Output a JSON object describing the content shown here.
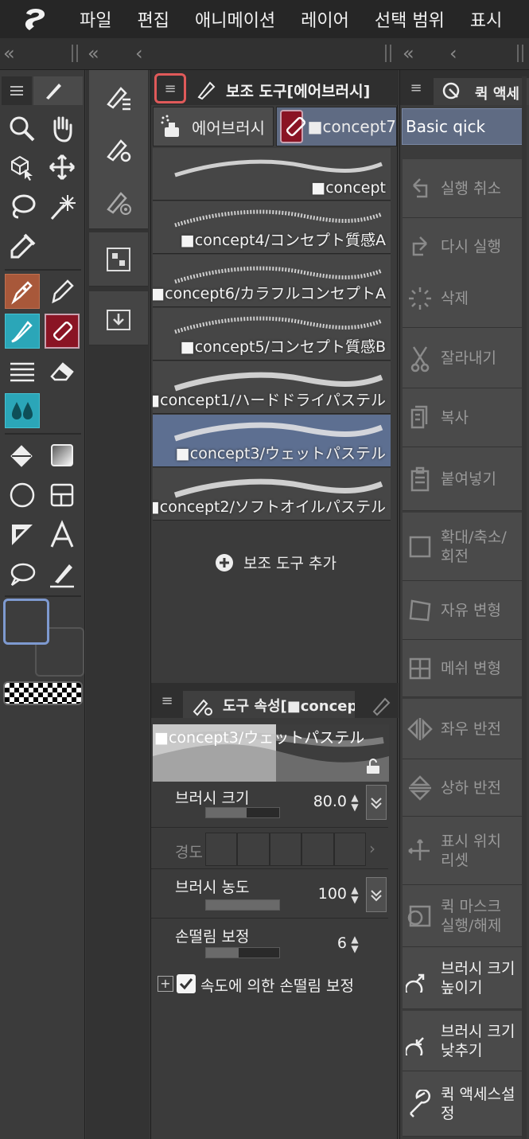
{
  "menubar": {
    "logo_icon": "clip-studio-logo-icon",
    "items": [
      "파일",
      "편집",
      "애니메이션",
      "레이어",
      "선택 범위",
      "표시"
    ]
  },
  "dock": {
    "collapse_left": "«",
    "collapse_right": "‹"
  },
  "tools_panel": {
    "tools": [
      "zoom-icon",
      "hand-icon",
      "object-select-icon",
      "move-layer-icon",
      "lasso-icon",
      "magic-wand-icon",
      "eyedropper-icon",
      "pen-icon",
      "pencil-icon",
      "brush-icon",
      "airbrush-icon",
      "hatch-icon",
      "eraser-icon",
      "blend-icon",
      "fill-icon",
      "gradient-icon",
      "ellipse-icon",
      "frame-icon",
      "ruler-icon",
      "text-icon",
      "balloon-icon",
      "correct-line-icon"
    ],
    "main_color": "#3d3d3d",
    "sub_color": "#3d3d3d",
    "accent": "#7e9ad0"
  },
  "subtool_panel": {
    "title": "보조 도구[에어브러시]",
    "groups": [
      {
        "label": "에어브러시"
      },
      {
        "label": "■concept7"
      }
    ],
    "brushes": [
      {
        "name": "■concept",
        "selected": false
      },
      {
        "name": "■concept4/コンセプト質感A",
        "selected": false
      },
      {
        "name": "■concept6/カラフルコンセプトA",
        "selected": false
      },
      {
        "name": "■concept5/コンセプト質感B",
        "selected": false
      },
      {
        "name": "■concept1/ハードドライパステル",
        "selected": false
      },
      {
        "name": "■concept3/ウェットパステル",
        "selected": true
      },
      {
        "name": "■concept2/ソフトオイルパステル",
        "selected": false
      }
    ],
    "add_label": "보조 도구 추가",
    "highlight_color": "#e05a5a"
  },
  "property_panel": {
    "title": "도구 속성[■concep",
    "preview_name": "■concept3/ウェットパステル",
    "brush_size": {
      "label": "브러시 크기",
      "value": "80.0",
      "fill": 0.55
    },
    "hardness": {
      "label": "경도"
    },
    "density": {
      "label": "브러시 농도",
      "value": "100",
      "fill": 1.0
    },
    "stabilization": {
      "label": "손떨림 보정",
      "value": "6",
      "fill": 0.45
    },
    "speed_stab": {
      "label": "속도에 의한 손떨림 보정",
      "checked": true
    }
  },
  "quick_access": {
    "title": "퀵 액세",
    "set_name": "Basic qick",
    "items": [
      {
        "label": "실행 취소",
        "icon": "undo-icon",
        "enabled": false
      },
      {
        "label": "다시 실행",
        "icon": "redo-icon",
        "enabled": false
      },
      {
        "label": "삭제",
        "icon": "delete-icon",
        "enabled": false
      },
      {
        "label": "잘라내기",
        "icon": "scissors-icon",
        "enabled": false
      },
      {
        "label": "복사",
        "icon": "copy-icon",
        "enabled": false
      },
      {
        "label": "붙여넣기",
        "icon": "paste-icon",
        "enabled": false
      },
      {
        "label": "확대/축소/\n회전",
        "icon": "scale-rotate-icon",
        "enabled": false
      },
      {
        "label": "자유 변형",
        "icon": "free-transform-icon",
        "enabled": false
      },
      {
        "label": "메쉬 변형",
        "icon": "mesh-transform-icon",
        "enabled": false
      },
      {
        "label": "좌우 반전",
        "icon": "flip-horizontal-icon",
        "enabled": false
      },
      {
        "label": "상하 반전",
        "icon": "flip-vertical-icon",
        "enabled": false
      },
      {
        "label": "표시 위치\n리셋",
        "icon": "reset-view-icon",
        "enabled": false
      },
      {
        "label": "퀵 마스크\n실행/해제",
        "icon": "quick-mask-icon",
        "enabled": false
      },
      {
        "label": "브러시 크기\n높이기",
        "icon": "brush-size-up-icon",
        "enabled": true
      },
      {
        "label": "브러시 크기\n낮추기",
        "icon": "brush-size-down-icon",
        "enabled": true
      },
      {
        "label": "퀵 액세스설\n정",
        "icon": "wrench-icon",
        "enabled": true
      }
    ]
  }
}
